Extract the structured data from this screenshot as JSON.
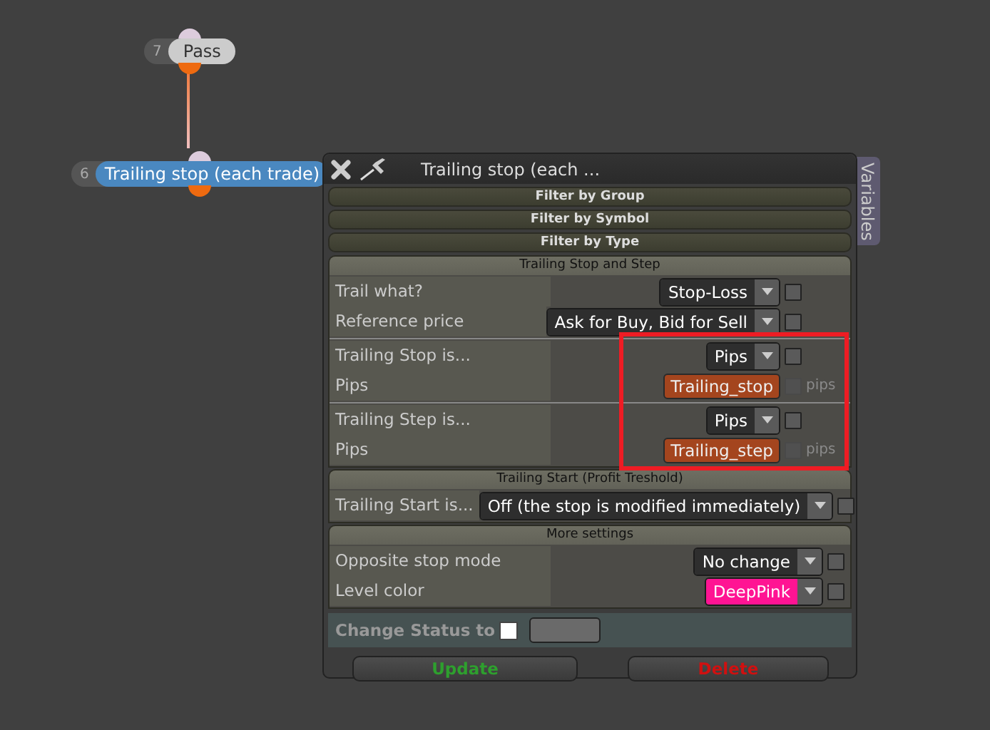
{
  "nodes": [
    {
      "number": "7",
      "label": "Pass",
      "selected": false
    },
    {
      "number": "6",
      "label": "Trailing stop (each trade)",
      "selected": true
    }
  ],
  "dialog": {
    "title": "Trailing stop (each ...",
    "side_tab": "Variables",
    "filters": [
      "Filter by Group",
      "Filter by Symbol",
      "Filter by Type"
    ],
    "sections": [
      {
        "title": "Trailing Stop and Step",
        "groups": [
          {
            "rows": [
              {
                "label": "Trail what?",
                "kind": "dropdown",
                "value": "Stop-Loss",
                "checked": false
              },
              {
                "label": "Reference price",
                "kind": "dropdown",
                "value": "Ask for Buy, Bid for Sell",
                "checked": false
              }
            ]
          },
          {
            "rows": [
              {
                "label": "Trailing Stop is...",
                "kind": "dropdown",
                "value": "Pips",
                "checked": false
              },
              {
                "label": "Pips",
                "kind": "variable",
                "value": "Trailing_stop",
                "unit": "pips",
                "checked": false
              }
            ]
          },
          {
            "rows": [
              {
                "label": "Trailing Step is...",
                "kind": "dropdown",
                "value": "Pips",
                "checked": false
              },
              {
                "label": "Pips",
                "kind": "variable",
                "value": "Trailing_step",
                "unit": "pips",
                "checked": false
              }
            ]
          }
        ]
      },
      {
        "title": "Trailing Start (Profit Treshold)",
        "groups": [
          {
            "rows": [
              {
                "label": "Trailing Start is...",
                "kind": "dropdown",
                "value": "Off (the stop is modified immediately)",
                "checked": false
              }
            ]
          }
        ]
      },
      {
        "title": "More settings",
        "groups": [
          {
            "rows": [
              {
                "label": "Opposite stop mode",
                "kind": "dropdown",
                "value": "No change",
                "checked": false
              },
              {
                "label": "Level color",
                "kind": "dropdown",
                "value": "DeepPink",
                "color": "#ff1493",
                "checked": false
              }
            ]
          }
        ]
      }
    ],
    "status": {
      "label": "Change Status to",
      "checked": false
    },
    "buttons": [
      {
        "label": "Update",
        "kind": "update"
      },
      {
        "label": "Delete",
        "kind": "delete"
      }
    ]
  },
  "annotations": [
    {
      "kind": "highlight"
    }
  ]
}
